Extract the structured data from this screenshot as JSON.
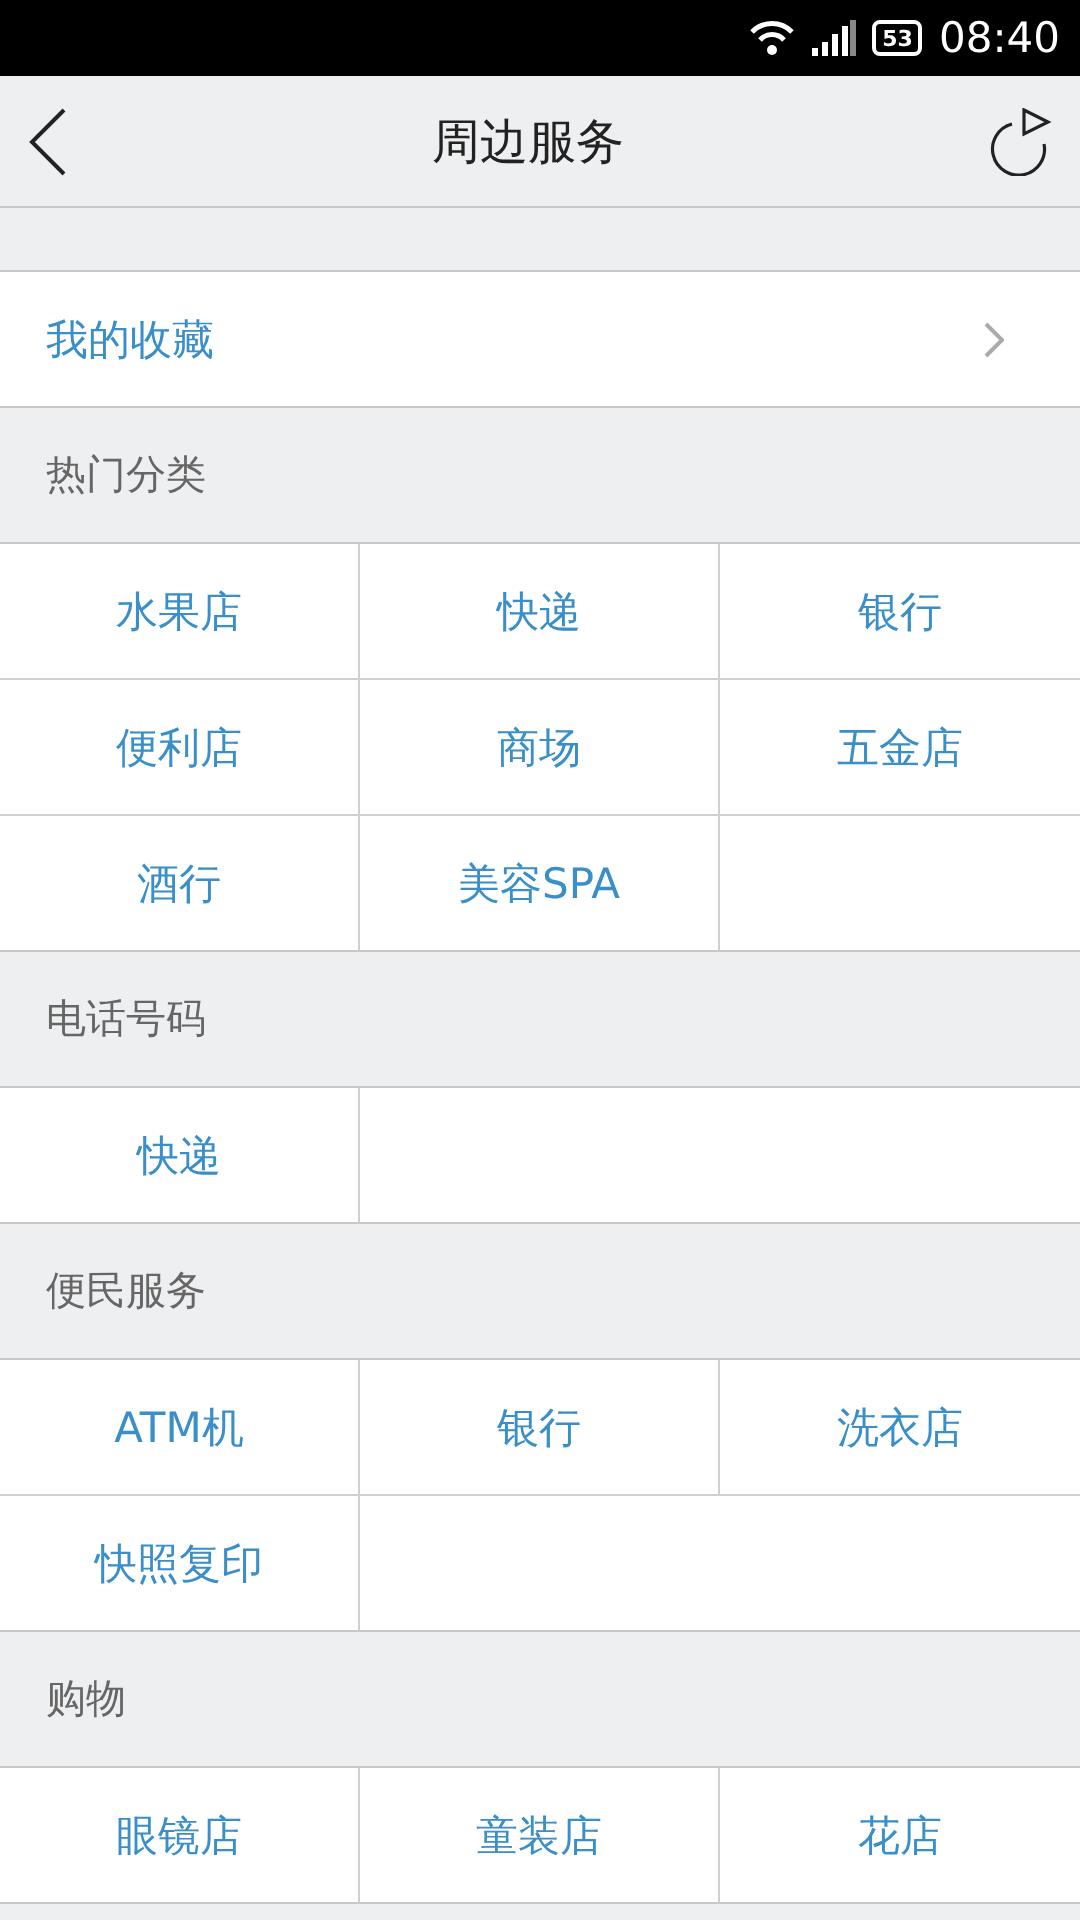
{
  "status_bar": {
    "battery": "53",
    "time": "08:40"
  },
  "header": {
    "title": "周边服务"
  },
  "favorites": {
    "label": "我的收藏"
  },
  "sections": [
    {
      "title": "热门分类",
      "items": [
        "水果店",
        "快递",
        "银行",
        "便利店",
        "商场",
        "五金店",
        "酒行",
        "美容SPA"
      ]
    },
    {
      "title": "电话号码",
      "items": [
        "快递"
      ]
    },
    {
      "title": "便民服务",
      "items": [
        "ATM机",
        "银行",
        "洗衣店",
        "快照复印"
      ]
    },
    {
      "title": "购物",
      "items": [
        "眼镜店",
        "童装店",
        "花店"
      ]
    }
  ]
}
